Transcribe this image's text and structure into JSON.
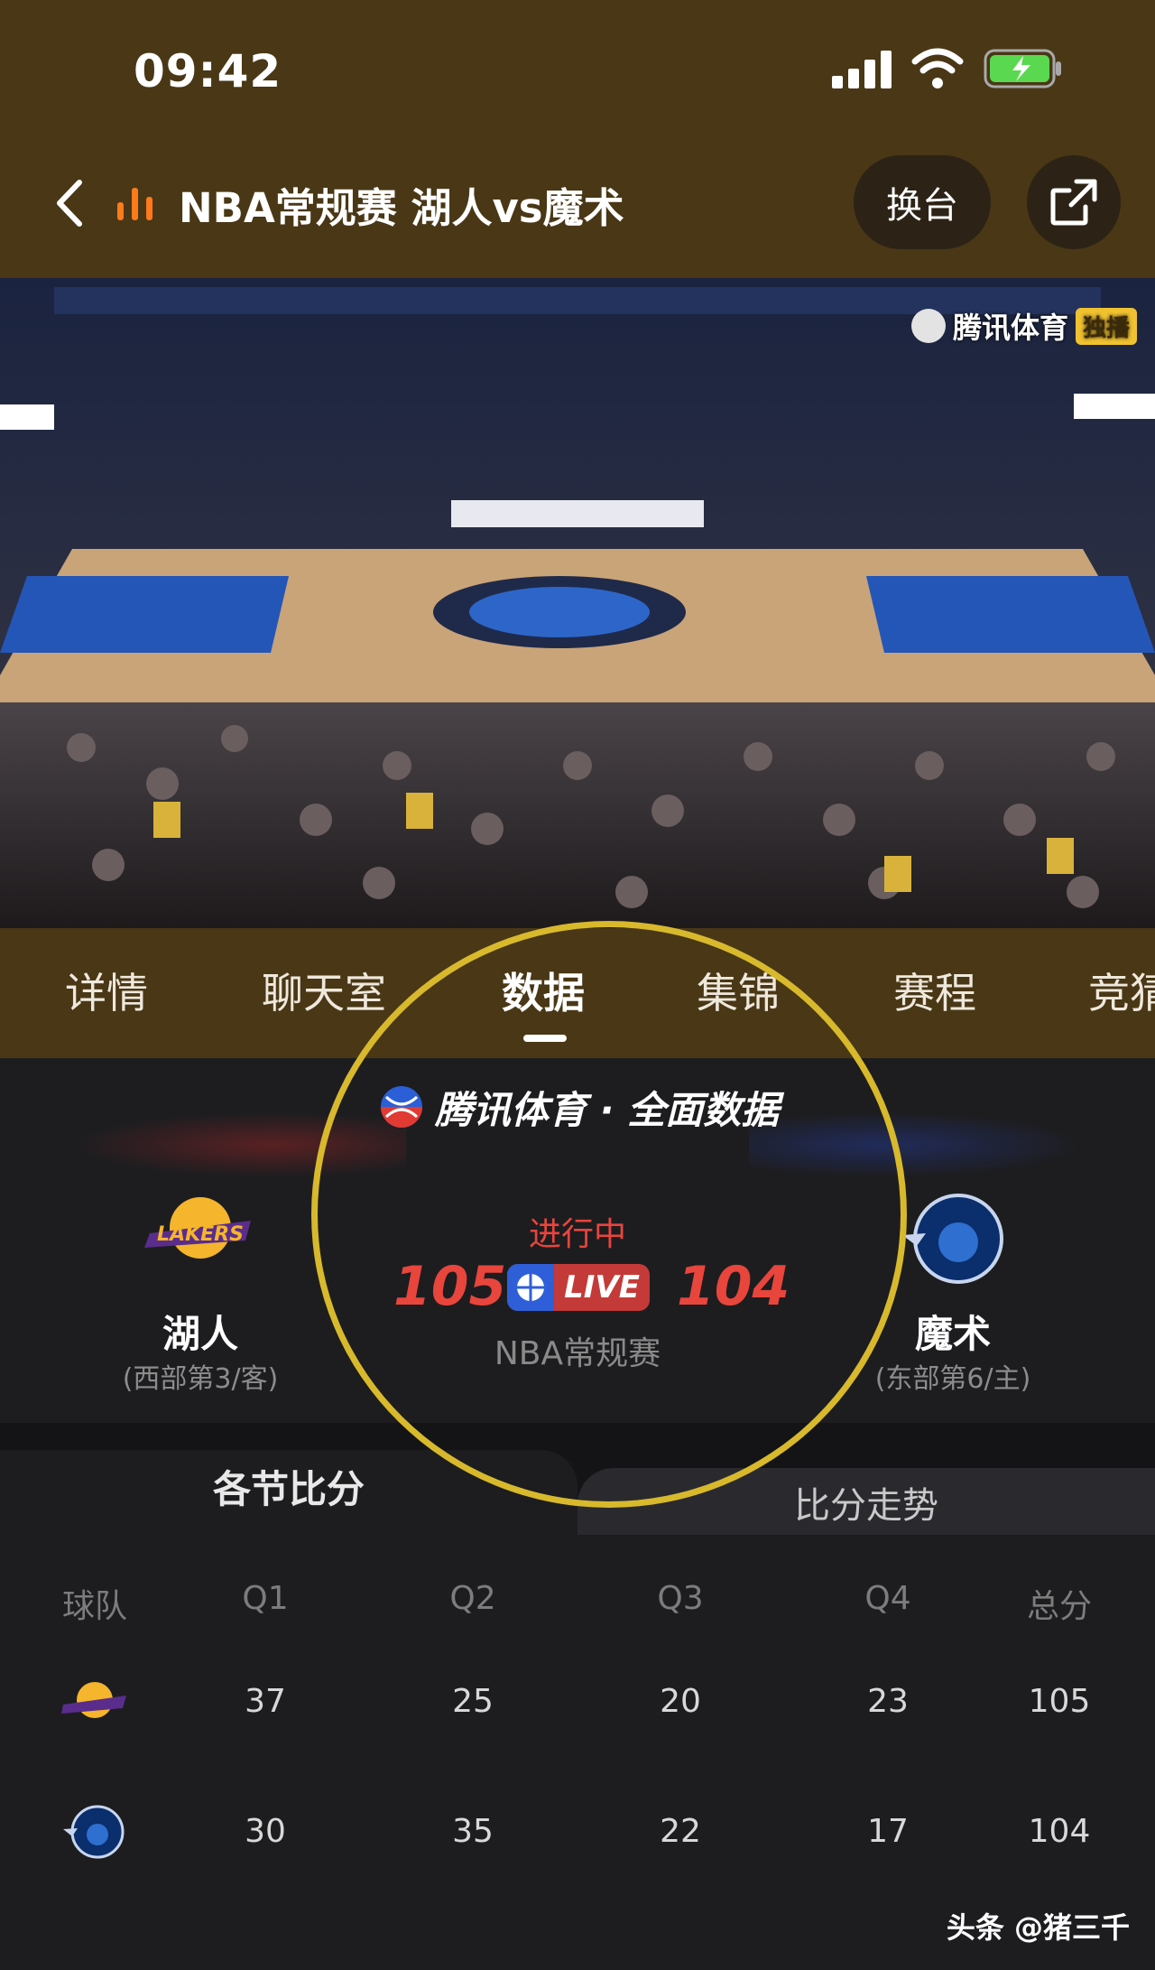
{
  "status_bar": {
    "time": "09:42"
  },
  "header": {
    "title": "NBA常规赛 湖人vs魔术",
    "switch_label": "换台"
  },
  "video": {
    "watermark": "腾讯体育",
    "watermark_badge": "独播"
  },
  "tabs": [
    {
      "label": "详情",
      "active": false
    },
    {
      "label": "聊天室",
      "active": false
    },
    {
      "label": "数据",
      "active": true
    },
    {
      "label": "集锦",
      "active": false
    },
    {
      "label": "赛程",
      "active": false
    },
    {
      "label": "竞猜",
      "active": false
    }
  ],
  "match": {
    "brand": "腾讯体育 · 全面数据",
    "status": "进行中",
    "league": "NBA常规赛",
    "live_label": "LIVE",
    "home": {
      "name": "湖人",
      "sub": "(西部第3/客)",
      "score": "105"
    },
    "away": {
      "name": "魔术",
      "sub": "(东部第6/主)",
      "score": "104"
    }
  },
  "sections": {
    "left": "各节比分",
    "right": "比分走势"
  },
  "quarter_table": {
    "headers": [
      "球队",
      "Q1",
      "Q2",
      "Q3",
      "Q4",
      "总分"
    ],
    "rows": [
      {
        "team": "湖人",
        "values": [
          "37",
          "25",
          "20",
          "23",
          "105"
        ]
      },
      {
        "team": "魔术",
        "values": [
          "30",
          "35",
          "22",
          "17",
          "104"
        ]
      }
    ]
  },
  "credit": "头条 @猪三千",
  "colors": {
    "header_bg": "#493716",
    "score_red": "#e8453c",
    "highlight": "#d8b92c"
  }
}
